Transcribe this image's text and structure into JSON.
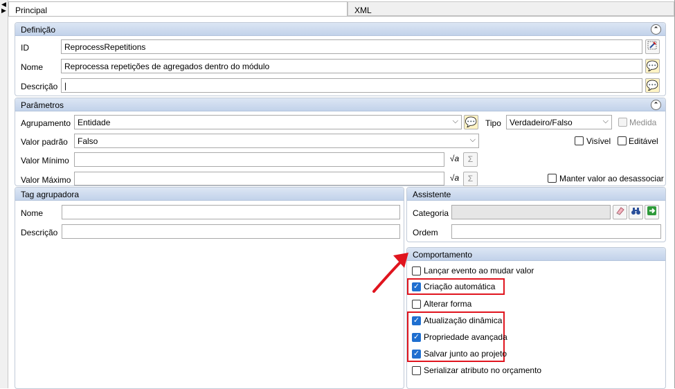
{
  "tabs": [
    "Principal",
    "XML"
  ],
  "definicao": {
    "title": "Definição",
    "id_label": "ID",
    "id_value": "ReprocessRepetitions",
    "nome_label": "Nome",
    "nome_value": "Reprocessa repetições de agregados dentro do módulo",
    "descricao_label": "Descrição",
    "descricao_value": "|"
  },
  "parametros": {
    "title": "Parâmetros",
    "agrupamento_label": "Agrupamento",
    "agrupamento_value": "Entidade",
    "tipo_label": "Tipo",
    "tipo_value": "Verdadeiro/Falso",
    "medida_label": "Medida",
    "valor_padrao_label": "Valor padrão",
    "valor_padrao_value": "Falso",
    "visivel_label": "Visível",
    "editavel_label": "Editável",
    "valor_minimo_label": "Valor Mínimo",
    "valor_maximo_label": "Valor Máximo",
    "manter_label": "Manter valor ao desassociar",
    "sigma": "Σ"
  },
  "tag": {
    "title": "Tag agrupadora",
    "nome_label": "Nome",
    "descricao_label": "Descrição"
  },
  "assistente": {
    "title": "Assistente",
    "categoria_label": "Categoria",
    "ordem_label": "Ordem"
  },
  "comportamento": {
    "title": "Comportamento",
    "items": [
      {
        "label": "Lançar evento ao mudar valor",
        "checked": false
      },
      {
        "label": "Criação automática",
        "checked": true
      },
      {
        "label": "Alterar forma",
        "checked": false
      },
      {
        "label": "Atualização dinâmica",
        "checked": true
      },
      {
        "label": "Propriedade avançada",
        "checked": true
      },
      {
        "label": "Salvar junto ao projeto",
        "checked": true
      },
      {
        "label": "Serializar atributo no orçamento",
        "checked": false
      }
    ]
  },
  "colors": {
    "highlight": "#e0141e",
    "accent": "#1f6fd0"
  },
  "glyphs": {
    "check": "✓",
    "collapse": "⌃",
    "chevron": "⌵",
    "speech": "💬",
    "arrow": "▶"
  }
}
